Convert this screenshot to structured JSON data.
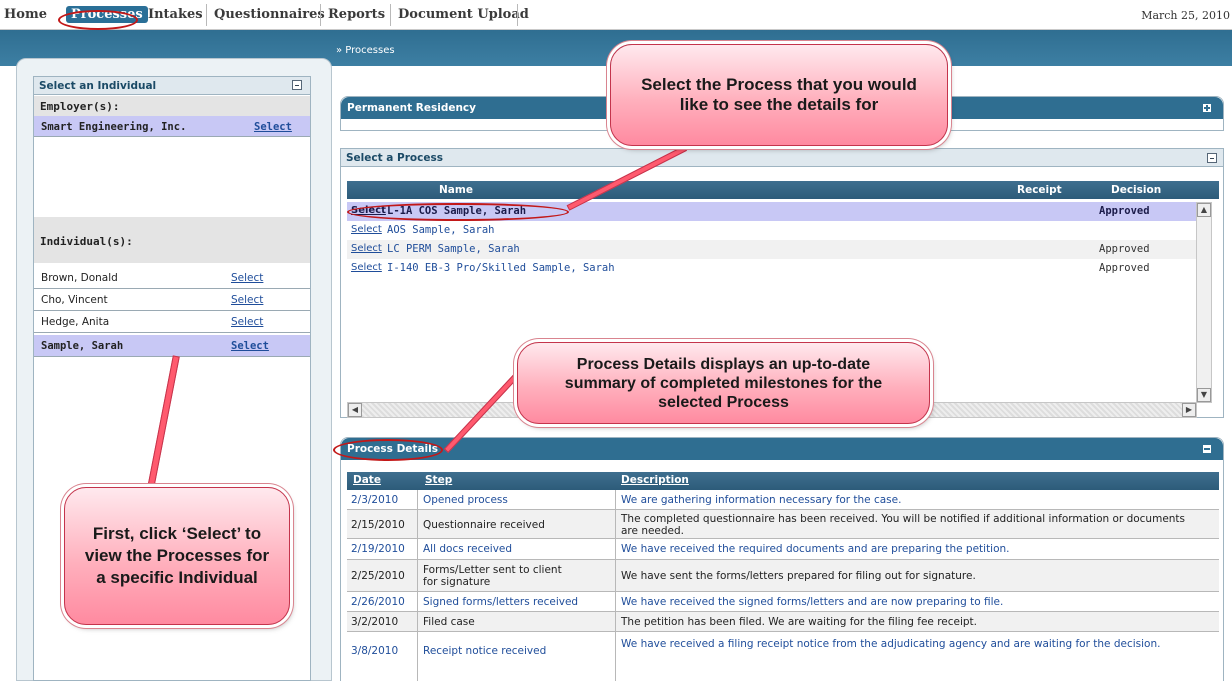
{
  "nav": {
    "home": "Home",
    "processes": "Processes",
    "intakes": "Intakes",
    "questionnaires": "Questionnaires",
    "reports": "Reports",
    "document_upload": "Document Upload",
    "date": "March 25, 2010"
  },
  "breadcrumb": "» Processes",
  "left_panel": {
    "title": "Select an Individual",
    "employers_label": "Employer(s):",
    "employer": {
      "name": "Smart Engineering, Inc.",
      "select": "Select"
    },
    "individuals_label": "Individual(s):",
    "individuals": [
      {
        "name": "Brown, Donald",
        "select": "Select"
      },
      {
        "name": "Cho, Vincent",
        "select": "Select"
      },
      {
        "name": "Hedge, Anita",
        "select": "Select"
      },
      {
        "name": "Sample, Sarah",
        "select": "Select"
      }
    ]
  },
  "permanent_residency": {
    "title": "Permanent Residency"
  },
  "process_panel": {
    "title": "Select a Process",
    "columns": {
      "name": "Name",
      "receipt": "Receipt",
      "decision": "Decision"
    },
    "rows": [
      {
        "select": "Select",
        "name": "L-1A COS Sample, Sarah",
        "decision": "Approved"
      },
      {
        "select": "Select",
        "name": "AOS Sample, Sarah",
        "decision": ""
      },
      {
        "select": "Select",
        "name": "LC PERM Sample, Sarah",
        "decision": "Approved"
      },
      {
        "select": "Select",
        "name": "I-140 EB-3 Pro/Skilled Sample, Sarah",
        "decision": "Approved"
      }
    ]
  },
  "details_panel": {
    "title": "Process Details",
    "columns": {
      "date": "Date",
      "step": "Step",
      "description": "Description"
    },
    "rows": [
      {
        "date": "2/3/2010",
        "step": "Opened process",
        "description": "We are gathering information necessary for the case."
      },
      {
        "date": "2/15/2010",
        "step": "Questionnaire received",
        "description": "The completed questionnaire has been received. You will be notified if additional information or documents are needed."
      },
      {
        "date": "2/19/2010",
        "step": "All docs received",
        "description": "We have received the required documents and are preparing the petition."
      },
      {
        "date": "2/25/2010",
        "step": "Forms/Letter sent to client for signature",
        "description": "We have sent the forms/letters prepared for filing out for signature."
      },
      {
        "date": "2/26/2010",
        "step": "Signed forms/letters received",
        "description": "We have received the signed forms/letters and are now preparing to file."
      },
      {
        "date": "3/2/2010",
        "step": "Filed case",
        "description": "The petition has been filed. We are waiting for the filing fee receipt."
      },
      {
        "date": "3/8/2010",
        "step": "Receipt notice received",
        "description": "We have received a filing receipt notice from the adjudicating agency and are waiting for the decision."
      }
    ]
  },
  "callouts": {
    "process_select": "Select the Process that you would like to see the details for",
    "process_details": "Process Details displays an up-to-date summary of completed milestones for the selected Process",
    "first_click": "First, click ‘Select’ to view the Processes for a specific Individual"
  }
}
